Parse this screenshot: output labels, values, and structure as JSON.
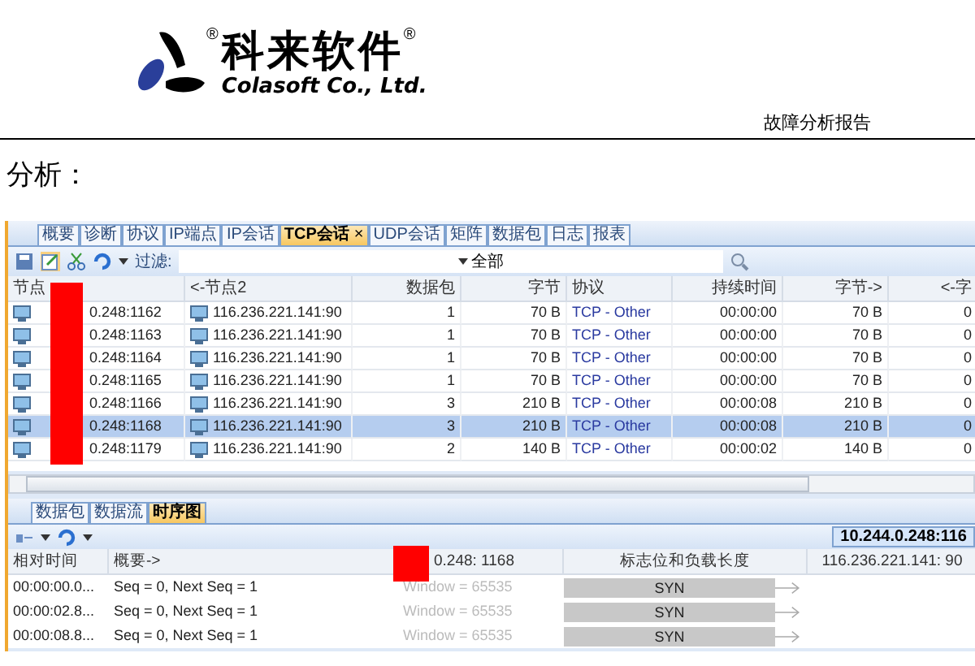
{
  "logo": {
    "mark": "®",
    "name_cn": "科来软件",
    "name_mark": "®",
    "name_en": "Colasoft Co., Ltd."
  },
  "header_right": "故障分析报告",
  "heading": "分析：",
  "app": {
    "tabs": [
      {
        "label": "概要",
        "selected": false
      },
      {
        "label": "诊断",
        "selected": false
      },
      {
        "label": "协议",
        "selected": false
      },
      {
        "label": "IP端点",
        "selected": false
      },
      {
        "label": "IP会话",
        "selected": false
      },
      {
        "label": "TCP会话",
        "selected": true,
        "close": "×"
      },
      {
        "label": "UDP会话",
        "selected": false
      },
      {
        "label": "矩阵",
        "selected": false
      },
      {
        "label": "数据包",
        "selected": false
      },
      {
        "label": "日志",
        "selected": false
      },
      {
        "label": "报表",
        "selected": false
      }
    ],
    "toolbar": {
      "filter_label": "过滤:",
      "filter_value": "全部"
    },
    "table": {
      "columns": [
        "节点",
        "<-节点2",
        "数据包",
        "字节",
        "协议",
        "持续时间",
        "字节->",
        "<-字"
      ],
      "rows": [
        {
          "selected": false,
          "cells": [
            "0.248:1162",
            "116.236.221.141:90",
            "1",
            "70  B",
            "TCP - Other",
            "00:00:00",
            "70  B",
            "0"
          ]
        },
        {
          "selected": false,
          "cells": [
            "0.248:1163",
            "116.236.221.141:90",
            "1",
            "70  B",
            "TCP - Other",
            "00:00:00",
            "70  B",
            "0"
          ]
        },
        {
          "selected": false,
          "cells": [
            "0.248:1164",
            "116.236.221.141:90",
            "1",
            "70  B",
            "TCP - Other",
            "00:00:00",
            "70  B",
            "0"
          ]
        },
        {
          "selected": false,
          "cells": [
            "0.248:1165",
            "116.236.221.141:90",
            "1",
            "70  B",
            "TCP - Other",
            "00:00:00",
            "70  B",
            "0"
          ]
        },
        {
          "selected": false,
          "cells": [
            "0.248:1166",
            "116.236.221.141:90",
            "3",
            "210  B",
            "TCP - Other",
            "00:00:08",
            "210  B",
            "0"
          ]
        },
        {
          "selected": true,
          "cells": [
            "0.248:1168",
            "116.236.221.141:90",
            "3",
            "210  B",
            "TCP - Other",
            "00:00:08",
            "210  B",
            "0"
          ]
        },
        {
          "selected": false,
          "cells": [
            "0.248:1179",
            "116.236.221.141:90",
            "2",
            "140  B",
            "TCP - Other",
            "00:00:02",
            "140  B",
            "0"
          ]
        }
      ]
    },
    "lower_tabs": [
      {
        "label": "数据包",
        "selected": false
      },
      {
        "label": "数据流",
        "selected": false
      },
      {
        "label": "时序图",
        "selected": true
      }
    ],
    "endpoint_label": "10.244.0.248:116",
    "sequence": {
      "columns": [
        "相对时间",
        "概要->",
        "0.248: 1168",
        "标志位和负载长度",
        "116.236.221.141: 90"
      ],
      "rows": [
        {
          "time": "00:00:00.0...",
          "summary": "Seq = 0, Next Seq = 1",
          "window": "Window = 65535",
          "flag": "SYN"
        },
        {
          "time": "00:00:02.8...",
          "summary": "Seq = 0, Next Seq = 1",
          "window": "Window = 65535",
          "flag": "SYN"
        },
        {
          "time": "00:00:08.8...",
          "summary": "Seq = 0, Next Seq = 1",
          "window": "Window = 65535",
          "flag": "SYN"
        }
      ]
    }
  }
}
